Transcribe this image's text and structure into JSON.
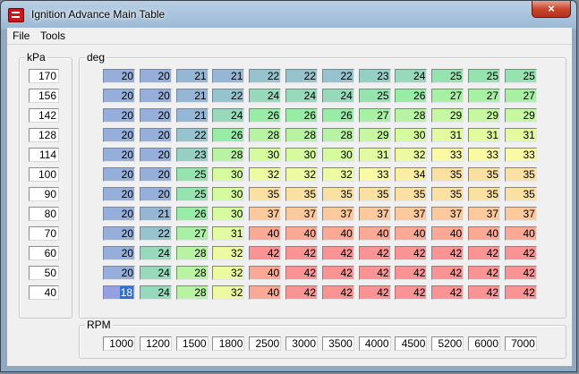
{
  "window": {
    "title": "Ignition Advance Main Table",
    "close_glyph": "×"
  },
  "menu": {
    "file": "File",
    "tools": "Tools"
  },
  "kpa": {
    "label": "kPa",
    "values": [
      "170",
      "156",
      "142",
      "128",
      "114",
      "100",
      "90",
      "80",
      "70",
      "60",
      "50",
      "40"
    ]
  },
  "table": {
    "label": "deg",
    "rows": [
      [
        "20",
        "20",
        "21",
        "21",
        "22",
        "22",
        "22",
        "23",
        "24",
        "25",
        "25",
        "25"
      ],
      [
        "20",
        "20",
        "21",
        "22",
        "24",
        "24",
        "24",
        "25",
        "26",
        "27",
        "27",
        "27"
      ],
      [
        "20",
        "20",
        "21",
        "24",
        "26",
        "26",
        "26",
        "27",
        "28",
        "29",
        "29",
        "29"
      ],
      [
        "20",
        "20",
        "22",
        "26",
        "28",
        "28",
        "28",
        "29",
        "30",
        "31",
        "31",
        "31"
      ],
      [
        "20",
        "20",
        "23",
        "28",
        "30",
        "30",
        "30",
        "31",
        "32",
        "33",
        "33",
        "33"
      ],
      [
        "20",
        "20",
        "25",
        "30",
        "32",
        "32",
        "32",
        "33",
        "34",
        "35",
        "35",
        "35"
      ],
      [
        "20",
        "20",
        "25",
        "30",
        "35",
        "35",
        "35",
        "35",
        "35",
        "35",
        "35",
        "35"
      ],
      [
        "20",
        "21",
        "26",
        "30",
        "37",
        "37",
        "37",
        "37",
        "37",
        "37",
        "37",
        "37"
      ],
      [
        "20",
        "22",
        "27",
        "31",
        "40",
        "40",
        "40",
        "40",
        "40",
        "40",
        "40",
        "40"
      ],
      [
        "20",
        "24",
        "28",
        "32",
        "42",
        "42",
        "42",
        "42",
        "42",
        "42",
        "42",
        "42"
      ],
      [
        "20",
        "24",
        "28",
        "32",
        "40",
        "42",
        "42",
        "42",
        "42",
        "42",
        "42",
        "42"
      ],
      [
        "18",
        "24",
        "28",
        "32",
        "40",
        "42",
        "42",
        "42",
        "42",
        "42",
        "42",
        "42"
      ]
    ],
    "selected": {
      "row": 11,
      "col": 0
    }
  },
  "rpm": {
    "label": "RPM",
    "values": [
      "1000",
      "1200",
      "1500",
      "1800",
      "2500",
      "3000",
      "3500",
      "4000",
      "4500",
      "5200",
      "6000",
      "7000"
    ]
  }
}
